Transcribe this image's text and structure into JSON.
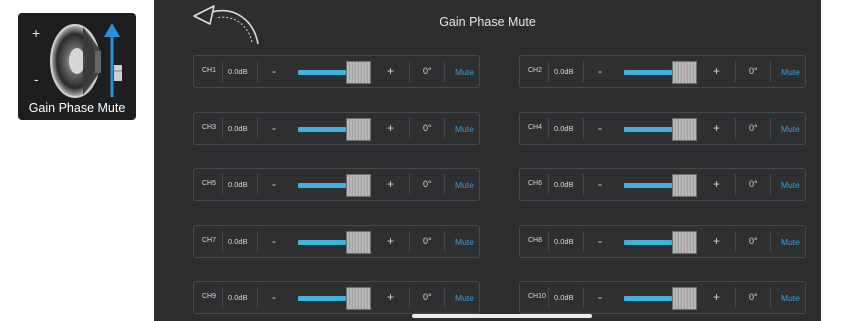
{
  "thumbnail": {
    "label": "Gain Phase Mute",
    "plus": "+",
    "minus": "-"
  },
  "panel": {
    "title": "Gain Phase Mute"
  },
  "channels": [
    {
      "name": "CH1",
      "gain": "0.0dB",
      "phase": "0°",
      "mute": "Mute",
      "level": 0.58
    },
    {
      "name": "CH2",
      "gain": "0.0dB",
      "phase": "0°",
      "mute": "Mute",
      "level": 0.58
    },
    {
      "name": "CH3",
      "gain": "0.0dB",
      "phase": "0°",
      "mute": "Mute",
      "level": 0.58
    },
    {
      "name": "CH4",
      "gain": "0.0dB",
      "phase": "0°",
      "mute": "Mute",
      "level": 0.58
    },
    {
      "name": "CH5",
      "gain": "0.0dB",
      "phase": "0°",
      "mute": "Mute",
      "level": 0.58
    },
    {
      "name": "CH6",
      "gain": "0.0dB",
      "phase": "0°",
      "mute": "Mute",
      "level": 0.58
    },
    {
      "name": "CH7",
      "gain": "0.0dB",
      "phase": "0°",
      "mute": "Mute",
      "level": 0.58
    },
    {
      "name": "CH8",
      "gain": "0.0dB",
      "phase": "0°",
      "mute": "Mute",
      "level": 0.58
    },
    {
      "name": "CH9",
      "gain": "0.0dB",
      "phase": "0°",
      "mute": "Mute",
      "level": 0.58
    },
    {
      "name": "CH10",
      "gain": "0.0dB",
      "phase": "0°",
      "mute": "Mute",
      "level": 0.58
    }
  ],
  "controls": {
    "minus": "-",
    "plus": "+"
  },
  "colors": {
    "accent": "#3fb3dc",
    "mute_text": "#3a9bdc",
    "panel_bg": "#2c2d2f"
  },
  "icons": {
    "back": "undo-arrow-icon",
    "speaker": "speaker-icon",
    "fader": "fader-icon"
  }
}
